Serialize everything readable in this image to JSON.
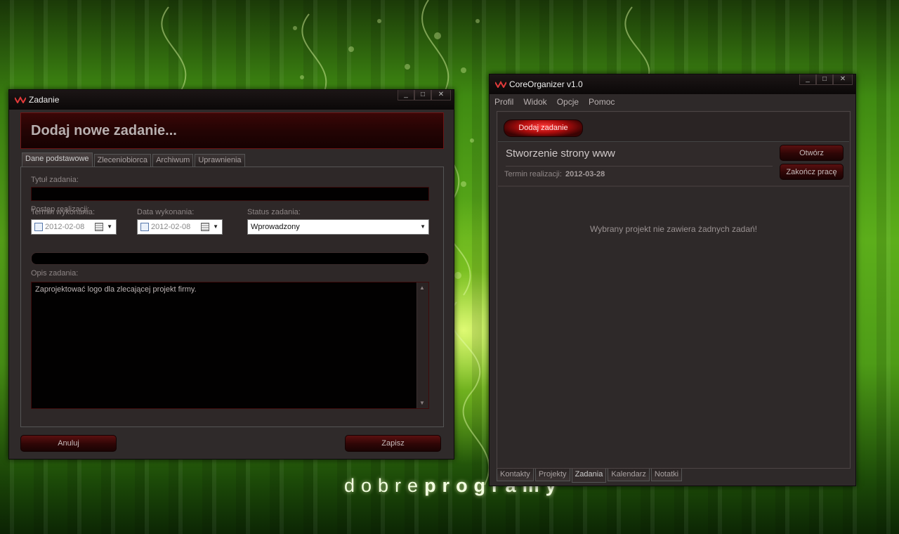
{
  "desktop": {
    "watermark_light": "dobre",
    "watermark_bold": "programy"
  },
  "dialog": {
    "title": "Zadanie",
    "window_buttons": {
      "minimize": "_",
      "maximize": "□",
      "close": "✕"
    },
    "header": "Dodaj nowe zadanie...",
    "tabs": [
      {
        "label": "Dane podstawowe",
        "active": true
      },
      {
        "label": "Zleceniobiorca",
        "active": false
      },
      {
        "label": "Archiwum",
        "active": false
      },
      {
        "label": "Uprawnienia",
        "active": false
      }
    ],
    "task_title_label": "Tytuł zadania:",
    "task_title_value": "",
    "progress_label": "Postęp realizacji:",
    "deadline_label": "Termin wykonania:",
    "deadline_value": "2012-02-08",
    "execution_date_label": "Data wykonania:",
    "execution_date_value": "2012-02-08",
    "status_label": "Status zadania:",
    "status_value": "Wprowadzony",
    "description_label": "Opis zadania:",
    "description_value": "Zaprojektować logo dla zlecającej projekt firmy.",
    "cancel_label": "Anuluj",
    "save_label": "Zapisz"
  },
  "main_window": {
    "title": "CoreOrganizer v1.0",
    "window_buttons": {
      "minimize": "_",
      "maximize": "□",
      "close": "✕"
    },
    "menu": [
      "Profil",
      "Widok",
      "Opcje",
      "Pomoc"
    ],
    "add_task_label": "Dodaj zadanie",
    "project_title": "Stworzenie strony www",
    "deadline_label": "Termin realizacji:",
    "deadline_value": "2012-03-28",
    "open_label": "Otwórz",
    "finish_label": "Zakończ pracę",
    "empty_message": "Wybrany projekt nie zawiera żadnych zadań!",
    "bottom_tabs": [
      {
        "label": "Kontakty",
        "active": false
      },
      {
        "label": "Projekty",
        "active": false
      },
      {
        "label": "Zadania",
        "active": true
      },
      {
        "label": "Kalendarz",
        "active": false
      },
      {
        "label": "Notatki",
        "active": false
      }
    ]
  }
}
